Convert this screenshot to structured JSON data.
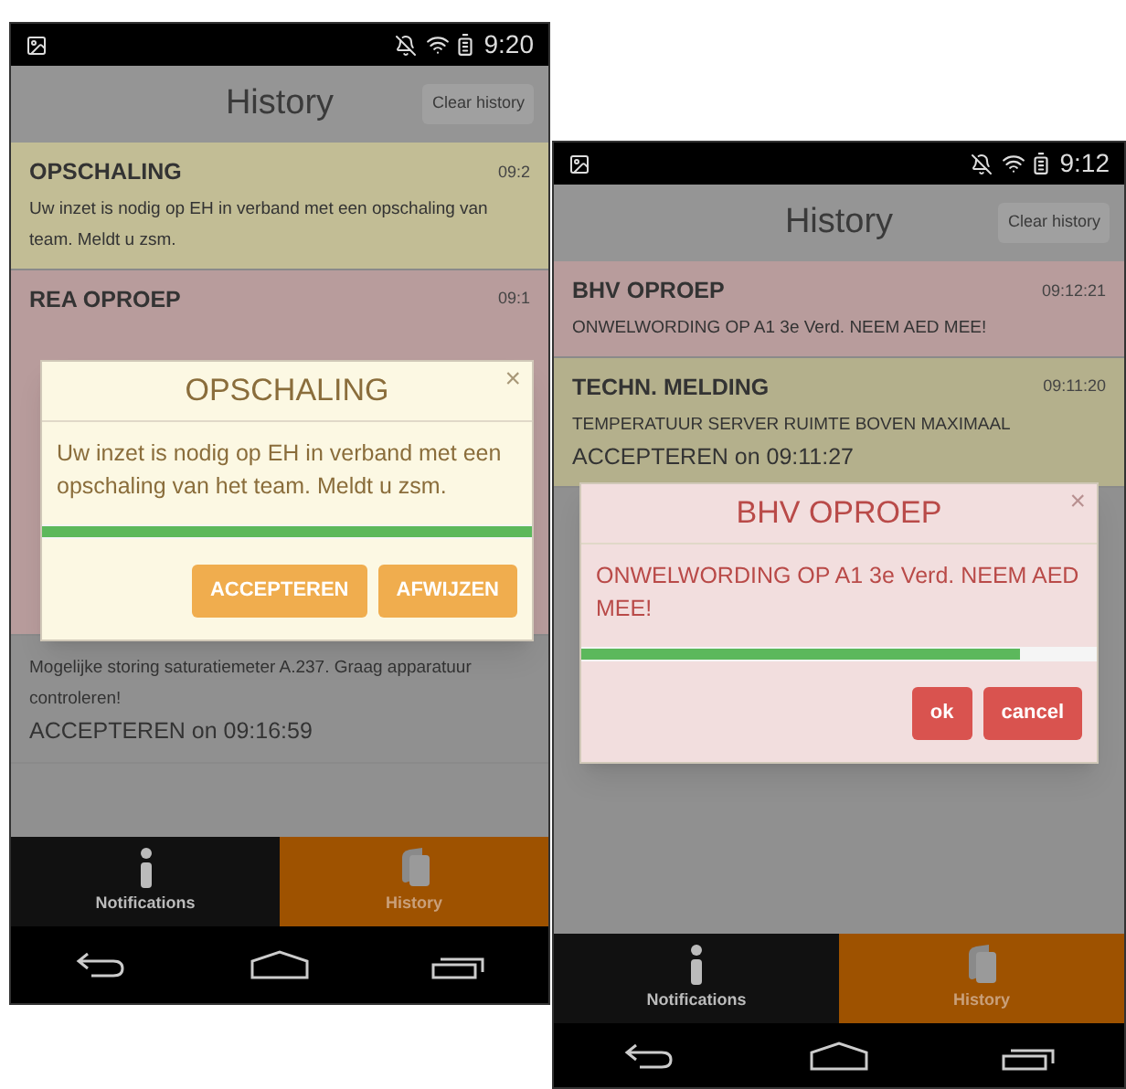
{
  "screens": [
    {
      "status_bar": {
        "time": "9:20"
      },
      "header": {
        "title": "History",
        "clear_button": "Clear history"
      },
      "items": [
        {
          "title": "OPSCHALING",
          "time": "09:2",
          "body": "Uw inzet is nodig op EH in verband met een opschaling van team. Meldt u zsm.",
          "color": "#c2bd95"
        },
        {
          "title": "REA OPROEP",
          "time": "09:1",
          "color": "#b89c9c"
        },
        {
          "body": "Mogelijke storing saturatiemeter A.237. Graag apparatuur controleren!",
          "status": "ACCEPTEREN on 09:16:59",
          "color": "#909090"
        }
      ],
      "dialog": {
        "kind": "warning",
        "title": "OPSCHALING",
        "close": "×",
        "message": "Uw inzet is nodig op EH in verband met een opschaling van het team. Meldt u zsm.",
        "level": 1.0,
        "buttons": [
          "ACCEPTEREN",
          "AFWIJZEN"
        ]
      },
      "tabs": [
        {
          "label": "Notifications",
          "selected": false
        },
        {
          "label": "History",
          "selected": true
        }
      ]
    },
    {
      "status_bar": {
        "time": "9:12"
      },
      "header": {
        "title": "History",
        "clear_button": "Clear history"
      },
      "items": [
        {
          "title": "BHV OPROEP",
          "time": "09:12:21",
          "body": "ONWELWORDING OP A1 3e Verd. NEEM AED MEE!",
          "color": "#b89c9c"
        },
        {
          "title": "TECHN. MELDING",
          "time": "09:11:20",
          "body": "TEMPERATUUR SERVER RUIMTE BOVEN MAXIMAAL",
          "status": "ACCEPTEREN on 09:11:27",
          "color": "#b4b08c"
        }
      ],
      "dialog": {
        "kind": "danger",
        "title": "BHV OPROEP",
        "close": "×",
        "message": "ONWELWORDING OP A1 3e Verd. NEEM AED MEE!",
        "level": 0.85,
        "buttons": [
          "ok",
          "cancel"
        ]
      },
      "tabs": [
        {
          "label": "Notifications",
          "selected": false
        },
        {
          "label": "History",
          "selected": true
        }
      ]
    }
  ]
}
